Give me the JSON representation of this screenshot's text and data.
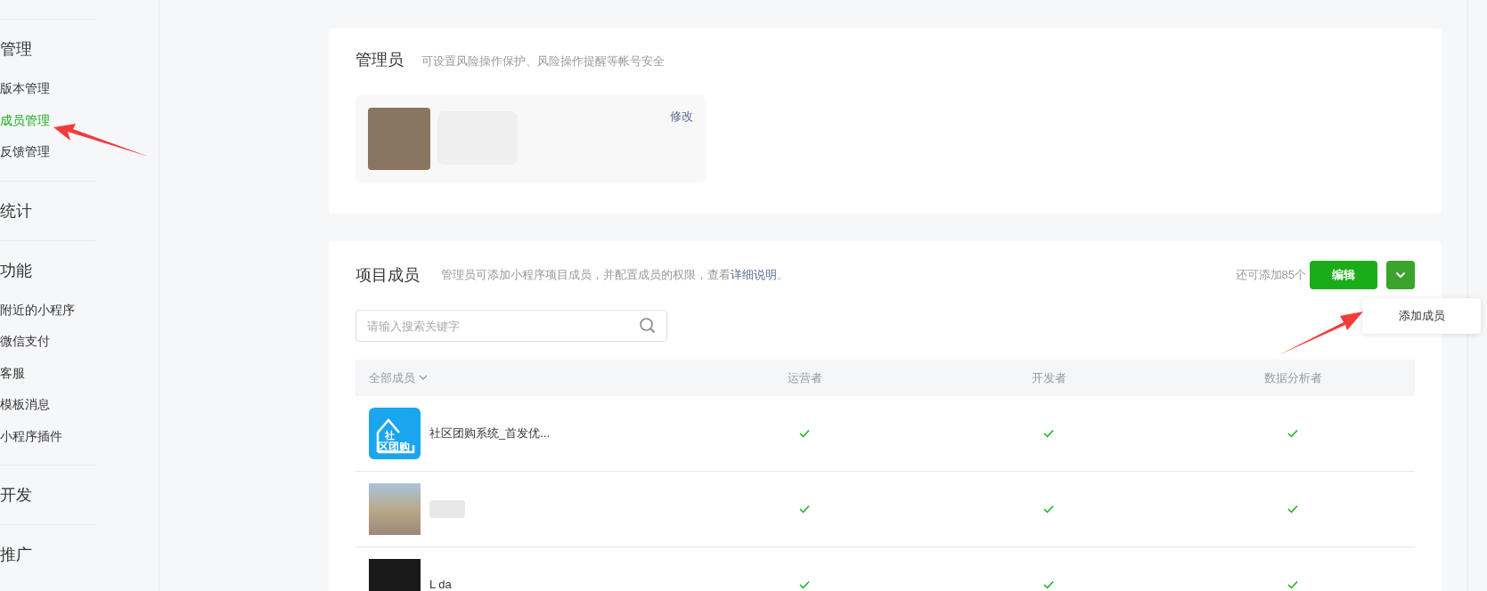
{
  "sidebar": {
    "groups": [
      {
        "title": "管理",
        "items": [
          {
            "label": "版本管理",
            "selected": false
          },
          {
            "label": "成员管理",
            "selected": true
          },
          {
            "label": "反馈管理",
            "selected": false
          }
        ]
      },
      {
        "title": "统计"
      },
      {
        "title": "功能",
        "items": [
          {
            "label": "附近的小程序",
            "selected": false
          },
          {
            "label": "微信支付",
            "selected": false
          },
          {
            "label": "客服",
            "selected": false
          },
          {
            "label": "模板消息",
            "selected": false
          },
          {
            "label": "小程序插件",
            "selected": false
          }
        ]
      },
      {
        "title": "开发"
      },
      {
        "title": "推广"
      }
    ]
  },
  "admin": {
    "title": "管理员",
    "description": "可设置风险操作保护、风险操作提醒等帐号安全",
    "edit_link": "修改"
  },
  "members": {
    "title": "项目成员",
    "description": "管理员可添加小程序项目成员，并配置成员的权限，查看",
    "link": "详细说明",
    "description_end": "。",
    "quota": "还可添加85个",
    "edit_button": "编辑",
    "menu": {
      "expanded": true,
      "items": [
        "添加成员"
      ]
    },
    "search": {
      "placeholder": "请输入搜索关键字"
    },
    "table": {
      "columns": [
        "全部成员",
        "运营者",
        "开发者",
        "数据分析者"
      ],
      "rows": [
        {
          "kind": "logo",
          "logo_text": [
            "社",
            "区团购"
          ],
          "name": "社区团购系统_首发优...",
          "roles": [
            true,
            true,
            true
          ]
        },
        {
          "kind": "photo",
          "roles": [
            true,
            true,
            true
          ]
        },
        {
          "kind": "dark",
          "name": "L da",
          "roles": [
            true,
            true,
            true
          ]
        }
      ]
    }
  }
}
